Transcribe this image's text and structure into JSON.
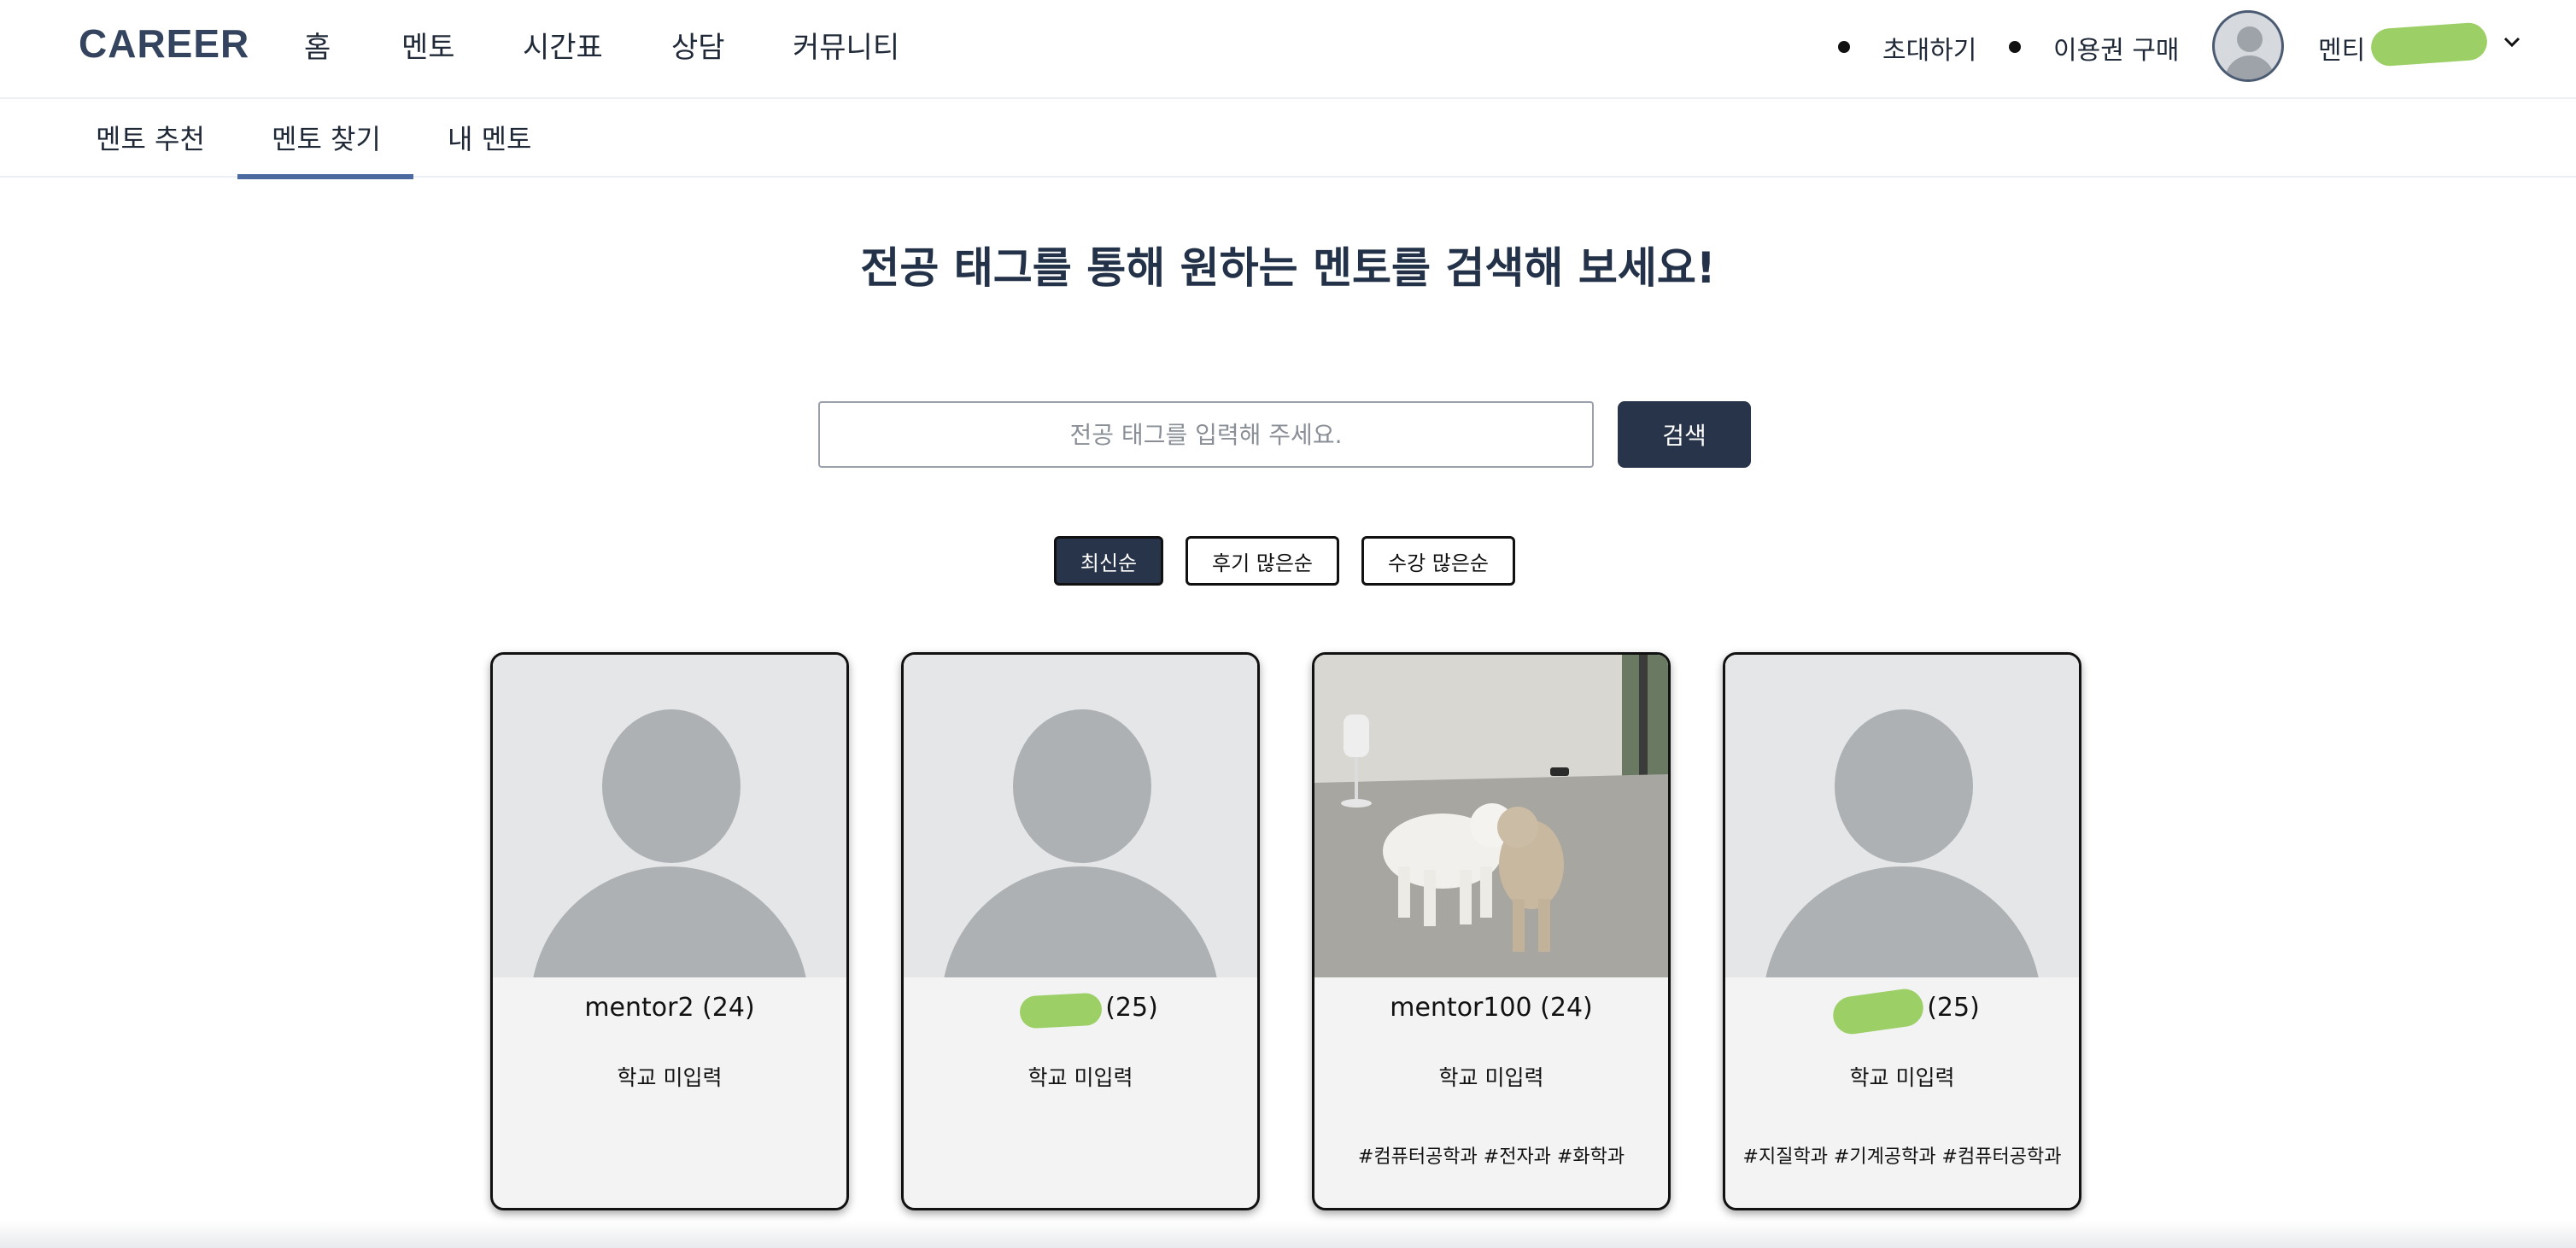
{
  "header": {
    "brand": "CAREER",
    "nav": [
      "홈",
      "멘토",
      "시간표",
      "상담",
      "커뮤니티"
    ],
    "links": {
      "invite": "초대하기",
      "purchase": "이용권 구매"
    },
    "user_role": "멘티"
  },
  "subnav": {
    "tabs": [
      "멘토 추천",
      "멘토 찾기",
      "내 멘토"
    ],
    "active_tab": "멘토 찾기"
  },
  "main": {
    "headline": "전공 태그를 통해 원하는 멘토를 검색해 보세요!",
    "search": {
      "placeholder": "전공 태그를 입력해 주세요.",
      "value": "",
      "button": "검색"
    },
    "sort": [
      "최신순",
      "후기 많은순",
      "수강 많은순"
    ],
    "active_sort": "최신순"
  },
  "mentors": [
    {
      "name": "mentor2 (24)",
      "school": "학교 미입력",
      "tags": "",
      "photo": "placeholder"
    },
    {
      "name": "(25)",
      "school": "학교 미입력",
      "tags": "",
      "photo": "placeholder"
    },
    {
      "name": "mentor100 (24)",
      "school": "학교 미입력",
      "tags": "#컴퓨터공학과 #전자과 #화학과",
      "photo": "dogs-in-room"
    },
    {
      "name": "(25)",
      "school": "학교 미입력",
      "tags": "#지질학과 #기계공학과 #컴퓨터공학과",
      "photo": "placeholder"
    }
  ],
  "colors": {
    "brand": "#34445e",
    "primary_button": "#283449",
    "active_tab_underline": "#4a6aa0",
    "redaction": "#9ccf66"
  }
}
